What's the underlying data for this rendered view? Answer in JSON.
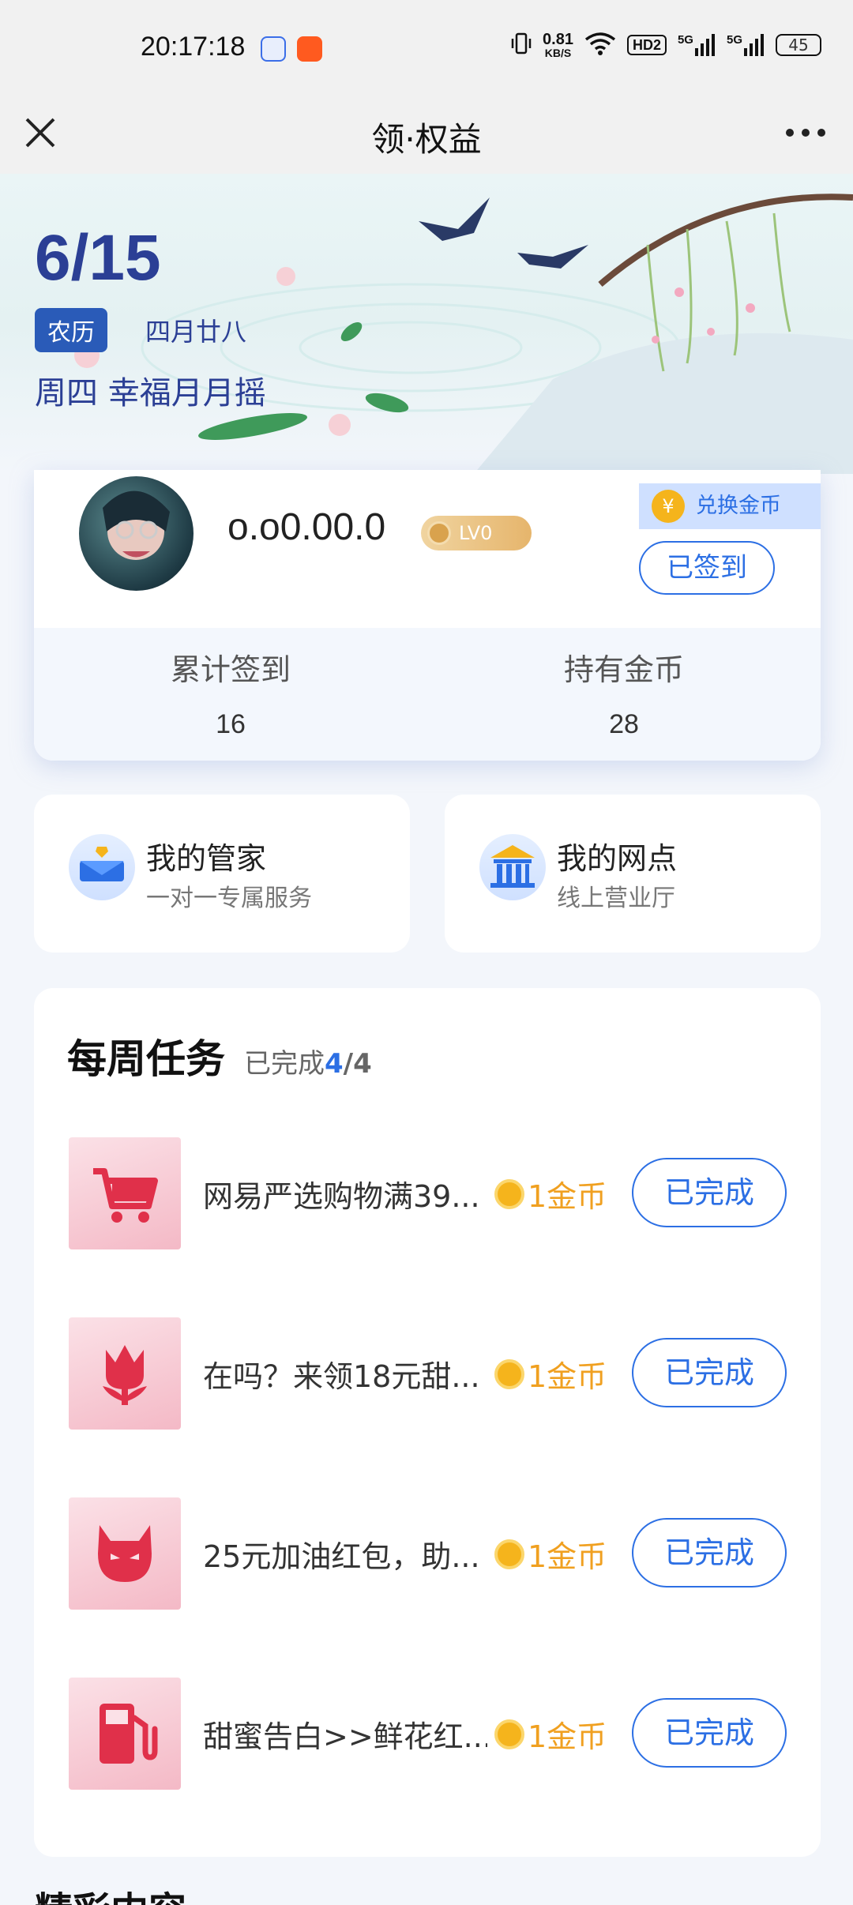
{
  "status_bar": {
    "time": "20:17:18",
    "network_speed": "0.81",
    "network_unit": "KB/S",
    "hd_label": "HD2",
    "signal1": "5G",
    "signal2": "5G",
    "battery": "45"
  },
  "header": {
    "title": "领·权益"
  },
  "banner": {
    "date": "6/15",
    "lunar_badge": "农历",
    "lunar_date": "四月廿八",
    "festival": "周四 幸福月月摇"
  },
  "profile": {
    "username": "o.o0.00.0",
    "level": "LV0",
    "exchange_label": "兑换金币",
    "signed_label": "已签到",
    "stats": [
      {
        "label": "累计签到",
        "value": "16"
      },
      {
        "label": "持有金币",
        "value": "28"
      }
    ]
  },
  "services": [
    {
      "title": "我的管家",
      "subtitle": "一对一专属服务",
      "icon": "butler-icon"
    },
    {
      "title": "我的网点",
      "subtitle": "线上营业厅",
      "icon": "bank-icon"
    }
  ],
  "weekly_tasks": {
    "title": "每周任务",
    "progress_label": "已完成",
    "done": "4",
    "total": "/4",
    "items": [
      {
        "name": "网易严选购物满39...",
        "reward": "1金币",
        "button": "已完成",
        "icon": "cart-icon"
      },
      {
        "name": "在吗？来领18元甜...",
        "reward": "1金币",
        "button": "已完成",
        "icon": "tulip-icon"
      },
      {
        "name": "25元加油红包，助...",
        "reward": "1金币",
        "button": "已完成",
        "icon": "devil-icon"
      },
      {
        "name": "甜蜜告白>>鲜花红...",
        "reward": "1金币",
        "button": "已完成",
        "icon": "fuel-pump-icon"
      }
    ]
  },
  "next_section": {
    "title": "精彩内容"
  },
  "colors": {
    "accent": "#2c6fe4",
    "title_blue": "#2b3f95",
    "gold": "#f0a020"
  }
}
